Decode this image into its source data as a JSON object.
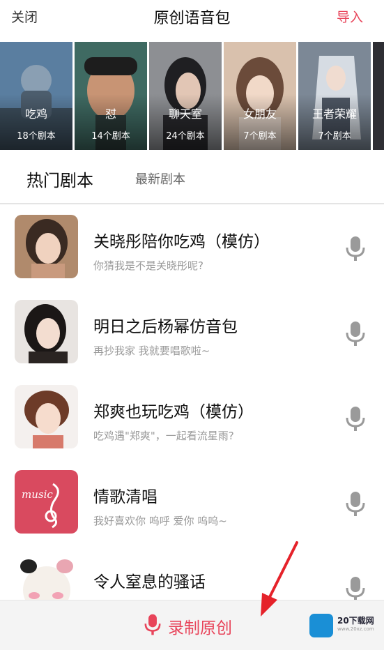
{
  "header": {
    "close_label": "关闭",
    "title": "原创语音包",
    "import_label": "导入"
  },
  "categories": [
    {
      "name": "吃鸡",
      "count": "18个剧本",
      "color": "#5a7ea0"
    },
    {
      "name": "怼",
      "count": "14个剧本",
      "color": "#3f6a62"
    },
    {
      "name": "聊天室",
      "count": "24个剧本",
      "color": "#5b5f66"
    },
    {
      "name": "女朋友",
      "count": "7个剧本",
      "color": "#c9a48e"
    },
    {
      "name": "王者荣耀",
      "count": "7个剧本",
      "color": "#6b7a8c"
    }
  ],
  "tabs": {
    "hot": "热门剧本",
    "new": "最新剧本"
  },
  "scripts": [
    {
      "title": "关晓彤陪你吃鸡（模仿）",
      "subtitle": "你猜我是不是关晓彤呢?"
    },
    {
      "title": "明日之后杨幂仿音包",
      "subtitle": "再抄我家 我就要唱歌啦~"
    },
    {
      "title": "郑爽也玩吃鸡（模仿）",
      "subtitle": "吃鸡遇\"郑爽\"，一起看流星雨?"
    },
    {
      "title": "情歌清唱",
      "subtitle": "我好喜欢你 呜呼 爱你 呜呜~",
      "thumb_text": "music"
    },
    {
      "title": "令人窒息的骚话",
      "subtitle": ""
    }
  ],
  "bottom": {
    "record_label": "录制原创"
  },
  "watermark": {
    "text": "20下载网",
    "sub": "www.20xz.com"
  },
  "colors": {
    "accent": "#e8445a",
    "mic": "#9a9a9a",
    "music_thumb": "#d94a5f"
  }
}
